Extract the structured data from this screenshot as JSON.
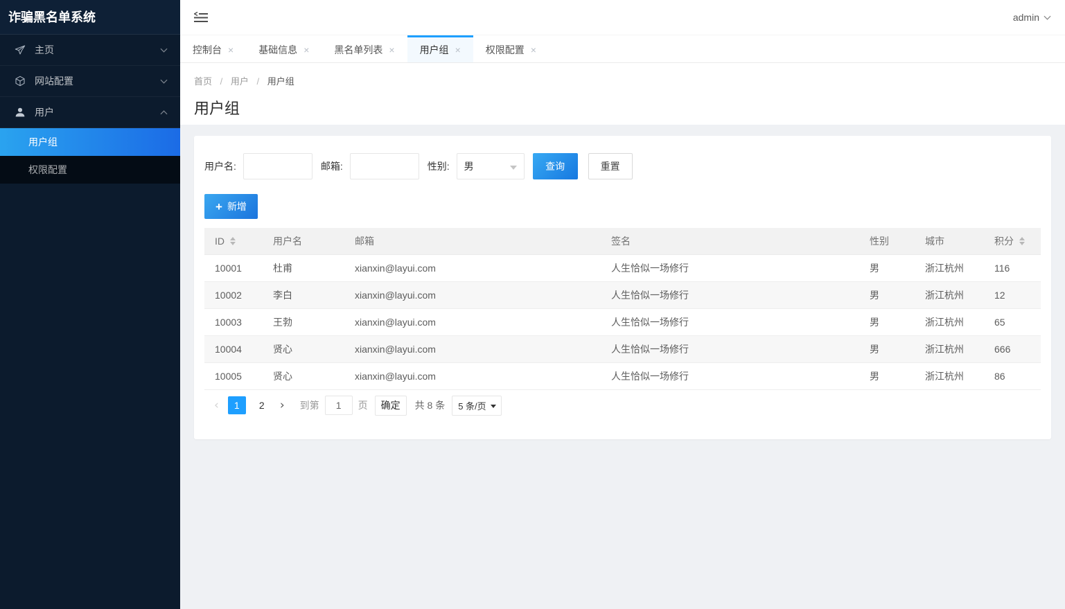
{
  "app": {
    "title": "诈骗黑名单系统"
  },
  "topbar": {
    "user": "admin"
  },
  "sidebar": {
    "items": [
      {
        "label": "主页",
        "icon": "paper-plane-icon",
        "state": "collapsed"
      },
      {
        "label": "网站配置",
        "icon": "cube-icon",
        "state": "collapsed"
      },
      {
        "label": "用户",
        "icon": "user-icon",
        "state": "expanded",
        "children": [
          {
            "label": "用户组",
            "active": true
          },
          {
            "label": "权限配置",
            "active": false
          }
        ]
      }
    ]
  },
  "tabs": [
    {
      "label": "控制台",
      "active": false
    },
    {
      "label": "基础信息",
      "active": false
    },
    {
      "label": "黑名单列表",
      "active": false
    },
    {
      "label": "用户组",
      "active": true
    },
    {
      "label": "权限配置",
      "active": false
    }
  ],
  "breadcrumb": {
    "items": [
      "首页",
      "用户",
      "用户组"
    ],
    "separator": "/"
  },
  "page": {
    "title": "用户组"
  },
  "filter": {
    "username_label": "用户名:",
    "username_value": "",
    "email_label": "邮箱:",
    "email_value": "",
    "gender_label": "性别:",
    "gender_value": "男",
    "search_label": "查询",
    "reset_label": "重置",
    "add_label": "新增",
    "add_plus": "+"
  },
  "table": {
    "columns": [
      "ID",
      "用户名",
      "邮箱",
      "签名",
      "性别",
      "城市",
      "积分"
    ],
    "sortable_columns": [
      "ID",
      "积分"
    ],
    "rows": [
      [
        "10001",
        "杜甫",
        "xianxin@layui.com",
        "人生恰似一场修行",
        "男",
        "浙江杭州",
        "116"
      ],
      [
        "10002",
        "李白",
        "xianxin@layui.com",
        "人生恰似一场修行",
        "男",
        "浙江杭州",
        "12"
      ],
      [
        "10003",
        "王勃",
        "xianxin@layui.com",
        "人生恰似一场修行",
        "男",
        "浙江杭州",
        "65"
      ],
      [
        "10004",
        "贤心",
        "xianxin@layui.com",
        "人生恰似一场修行",
        "男",
        "浙江杭州",
        "666"
      ],
      [
        "10005",
        "贤心",
        "xianxin@layui.com",
        "人生恰似一场修行",
        "男",
        "浙江杭州",
        "86"
      ]
    ]
  },
  "pagination": {
    "prev": "‹",
    "next": "›",
    "pages": [
      "1",
      "2"
    ],
    "current_page": "1",
    "goto_prefix": "到第",
    "goto_value": "1",
    "goto_suffix": "页",
    "confirm_label": "确定",
    "total_text": "共 8 条",
    "page_size": "5 条/页"
  },
  "colors": {
    "accent_blue": "#1E9FFF",
    "sidebar_bg": "#0c1b2d",
    "sidebar_submenu_bg": "#040c15",
    "active_gradient_start": "#2aa3ef",
    "active_gradient_end": "#1b6be6",
    "content_bg": "#eff1f4",
    "table_header_bg": "#f2f2f2",
    "table_stripe_bg": "#f7f7f7"
  }
}
